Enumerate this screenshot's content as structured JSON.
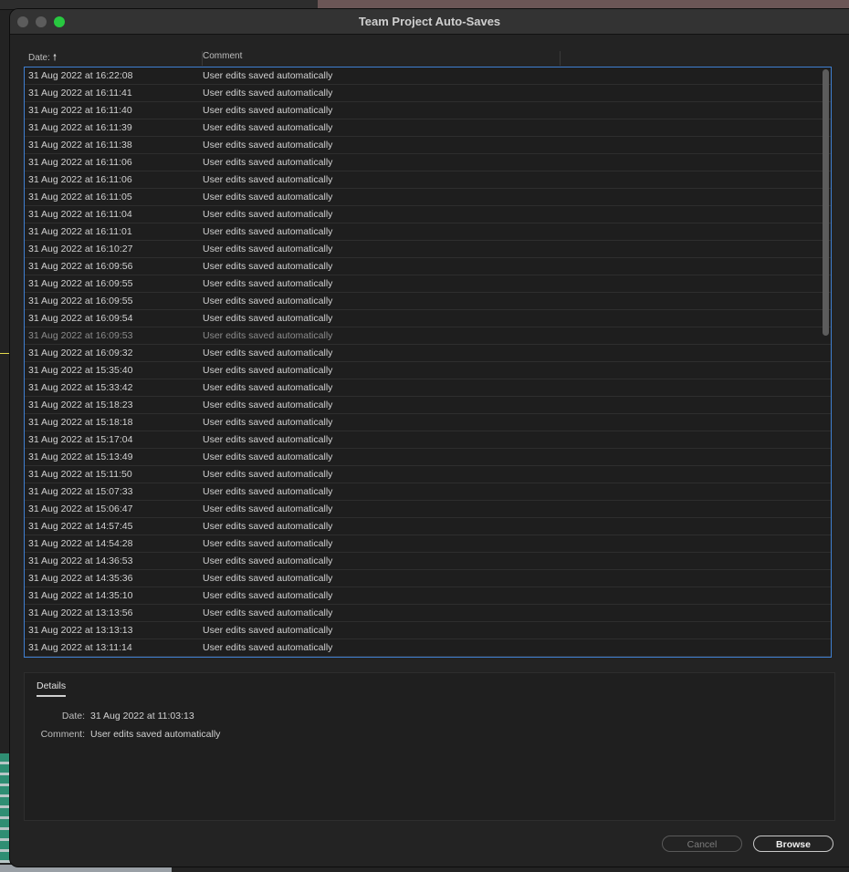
{
  "window": {
    "title": "Team Project Auto-Saves"
  },
  "columns": {
    "date": "Date:",
    "comment": "Comment"
  },
  "rows": [
    {
      "date": "31 Aug 2022 at 16:22:08",
      "comment": "User edits saved automatically"
    },
    {
      "date": "31 Aug 2022 at 16:11:41",
      "comment": "User edits saved automatically"
    },
    {
      "date": "31 Aug 2022 at 16:11:40",
      "comment": "User edits saved automatically"
    },
    {
      "date": "31 Aug 2022 at 16:11:39",
      "comment": "User edits saved automatically"
    },
    {
      "date": "31 Aug 2022 at 16:11:38",
      "comment": "User edits saved automatically"
    },
    {
      "date": "31 Aug 2022 at 16:11:06",
      "comment": "User edits saved automatically"
    },
    {
      "date": "31 Aug 2022 at 16:11:06",
      "comment": "User edits saved automatically"
    },
    {
      "date": "31 Aug 2022 at 16:11:05",
      "comment": "User edits saved automatically"
    },
    {
      "date": "31 Aug 2022 at 16:11:04",
      "comment": "User edits saved automatically"
    },
    {
      "date": "31 Aug 2022 at 16:11:01",
      "comment": "User edits saved automatically"
    },
    {
      "date": "31 Aug 2022 at 16:10:27",
      "comment": "User edits saved automatically"
    },
    {
      "date": "31 Aug 2022 at 16:09:56",
      "comment": "User edits saved automatically"
    },
    {
      "date": "31 Aug 2022 at 16:09:55",
      "comment": "User edits saved automatically"
    },
    {
      "date": "31 Aug 2022 at 16:09:55",
      "comment": "User edits saved automatically"
    },
    {
      "date": "31 Aug 2022 at 16:09:54",
      "comment": "User edits saved automatically"
    },
    {
      "date": "31 Aug 2022 at 16:09:53",
      "comment": "User edits saved automatically"
    },
    {
      "date": "31 Aug 2022 at 16:09:32",
      "comment": "User edits saved automatically"
    },
    {
      "date": "31 Aug 2022 at 15:35:40",
      "comment": "User edits saved automatically"
    },
    {
      "date": "31 Aug 2022 at 15:33:42",
      "comment": "User edits saved automatically"
    },
    {
      "date": "31 Aug 2022 at 15:18:23",
      "comment": "User edits saved automatically"
    },
    {
      "date": "31 Aug 2022 at 15:18:18",
      "comment": "User edits saved automatically"
    },
    {
      "date": "31 Aug 2022 at 15:17:04",
      "comment": "User edits saved automatically"
    },
    {
      "date": "31 Aug 2022 at 15:13:49",
      "comment": "User edits saved automatically"
    },
    {
      "date": "31 Aug 2022 at 15:11:50",
      "comment": "User edits saved automatically"
    },
    {
      "date": "31 Aug 2022 at 15:07:33",
      "comment": "User edits saved automatically"
    },
    {
      "date": "31 Aug 2022 at 15:06:47",
      "comment": "User edits saved automatically"
    },
    {
      "date": "31 Aug 2022 at 14:57:45",
      "comment": "User edits saved automatically"
    },
    {
      "date": "31 Aug 2022 at 14:54:28",
      "comment": "User edits saved automatically"
    },
    {
      "date": "31 Aug 2022 at 14:36:53",
      "comment": "User edits saved automatically"
    },
    {
      "date": "31 Aug 2022 at 14:35:36",
      "comment": "User edits saved automatically"
    },
    {
      "date": "31 Aug 2022 at 14:35:10",
      "comment": "User edits saved automatically"
    },
    {
      "date": "31 Aug 2022 at 13:13:56",
      "comment": "User edits saved automatically"
    },
    {
      "date": "31 Aug 2022 at 13:13:13",
      "comment": "User edits saved automatically"
    },
    {
      "date": "31 Aug 2022 at 13:11:14",
      "comment": "User edits saved automatically"
    }
  ],
  "dimmed_row_index": 15,
  "details": {
    "tab_label": "Details",
    "date_label": "Date:",
    "date_value": "31 Aug 2022 at 11:03:13",
    "comment_label": "Comment:",
    "comment_value": "User edits saved automatically"
  },
  "buttons": {
    "cancel": "Cancel",
    "browse": "Browse"
  },
  "colors": {
    "list_focus_border": "#3f7fd1",
    "traffic_green": "#28c840",
    "traffic_inactive": "#5c5c5c",
    "dialog_bg": "#232323"
  },
  "icons": {
    "sort": "arrow-up-icon"
  }
}
